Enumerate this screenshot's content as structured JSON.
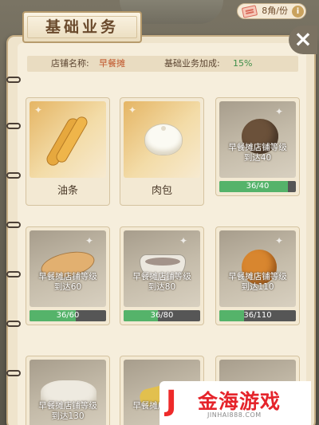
{
  "currency": {
    "label": "8角/份",
    "info_icon": "i"
  },
  "panel": {
    "title": "基础业务",
    "close_icon": "×",
    "info": {
      "shop_label": "店铺名称:",
      "shop_name": "早餐摊",
      "bonus_label": "基础业务加成:",
      "bonus_value": "15%"
    }
  },
  "cards": [
    {
      "name": "油条",
      "food": "youtiao",
      "unlocked": true
    },
    {
      "name": "肉包",
      "food": "bun",
      "unlocked": true
    },
    {
      "food": "egg",
      "unlocked": false,
      "lock_line1": "早餐摊店铺等级",
      "lock_line2": "到达40",
      "progress_text": "36/40",
      "progress": 0.9
    },
    {
      "food": "pancake",
      "unlocked": false,
      "lock_line1": "早餐摊店铺等级",
      "lock_line2": "到达60",
      "progress_text": "36/60",
      "progress": 0.6
    },
    {
      "food": "bowl",
      "unlocked": false,
      "lock_line1": "早餐摊店铺等级",
      "lock_line2": "到达80",
      "progress_text": "36/80",
      "progress": 0.45
    },
    {
      "food": "sesame",
      "unlocked": false,
      "lock_line1": "早餐摊店铺等级",
      "lock_line2": "到达110",
      "progress_text": "36/110",
      "progress": 0.327
    },
    {
      "food": "dumplings",
      "unlocked": false,
      "lock_line1": "早餐摊店铺等级",
      "lock_line2": "到达130"
    },
    {
      "food": "spring",
      "unlocked": false,
      "lock_line1": "早餐摊店铺等级"
    },
    {
      "food": "bao2",
      "unlocked": false
    }
  ],
  "watermark": {
    "logo": "J",
    "name": "金海游戏",
    "url": "JINHAI888.COM"
  },
  "colors": {
    "progress_fill": "#55b36a",
    "progress_track": "#565656",
    "accent_red": "#c0552a",
    "accent_green": "#3f8f4a"
  }
}
